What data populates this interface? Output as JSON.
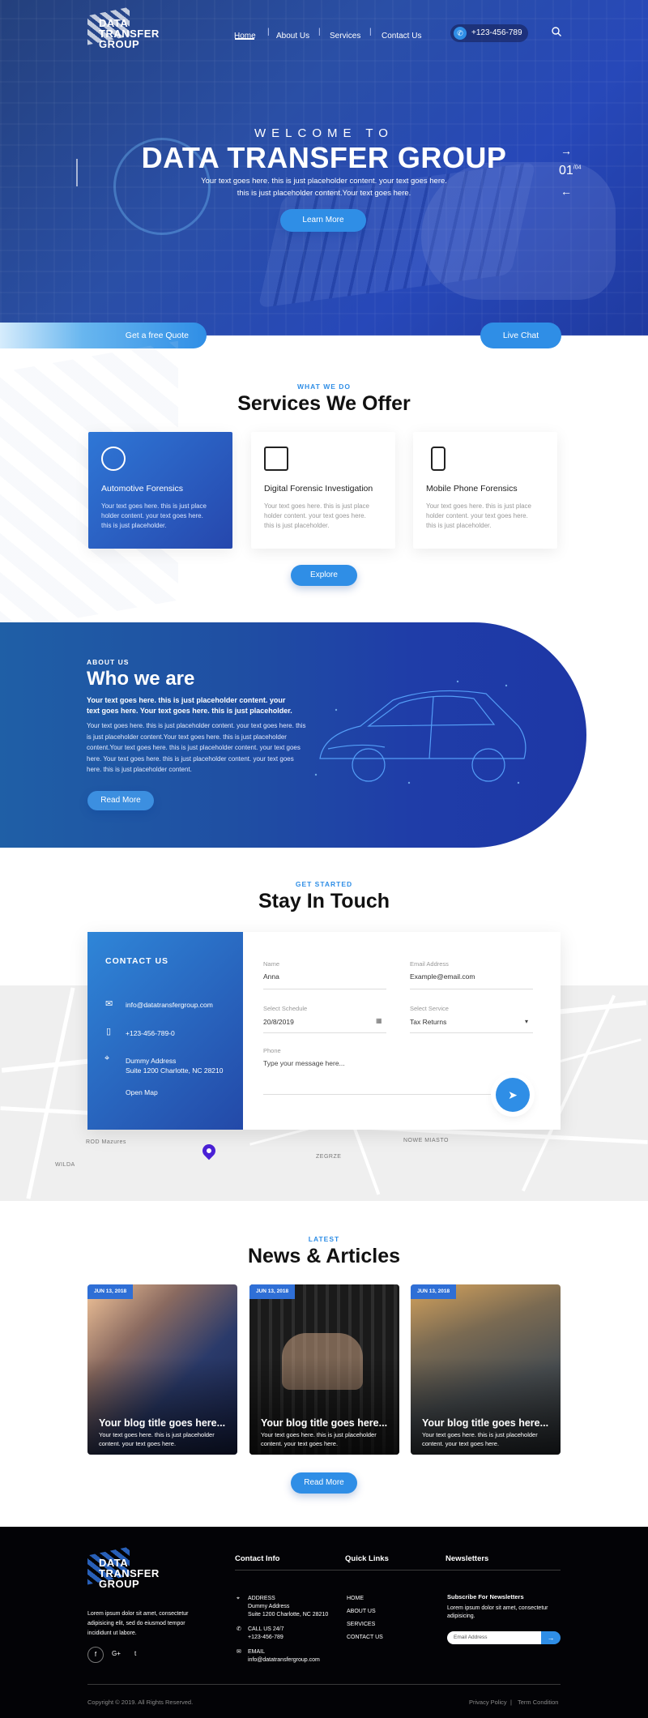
{
  "brand": {
    "logo_line1": "DATA",
    "logo_line2": "TRANSFER",
    "logo_line3": "GROUP",
    "accent": "#2f8ee6",
    "dark_blue": "#2647ad"
  },
  "nav": {
    "items": [
      "Home",
      "About Us",
      "Services",
      "Contact Us"
    ],
    "phone": "+123-456-789",
    "search_icon": "search-icon"
  },
  "hero": {
    "welcome": "WELCOME TO",
    "title": "DATA TRANSFER GROUP",
    "subtitle_line1": "Your text goes here. this is just placeholder content. your text goes here.",
    "subtitle_line2": "this is just placeholder content.Your text goes here.",
    "cta": "Learn More",
    "slide_current": "01",
    "slide_total": "/04",
    "quote_label": "Get a free Quote",
    "chat_label": "Live Chat"
  },
  "services": {
    "kicker": "WHAT WE DO",
    "title": "Services We Offer",
    "cards": [
      {
        "title": "Automotive Forensics",
        "body": "Your text goes here. this is just place holder content. your text goes here. this is just placeholder.",
        "icon": "steering-wheel-icon"
      },
      {
        "title": "Digital Forensic Investigation",
        "body": "Your text goes here. this is just place holder content. your text goes here. this is just placeholder.",
        "icon": "chip-icon"
      },
      {
        "title": "Mobile Phone Forensics",
        "body": "Your text goes here. this is just place holder content. your text goes here. this is just placeholder.",
        "icon": "mobile-phone-icon"
      }
    ],
    "cta": "Explore"
  },
  "about": {
    "kicker": "ABOUT US",
    "title": "Who we are",
    "lead": "Your text goes here. this is just placeholder content. your text goes here. Your text goes here. this is just placeholder.",
    "body": "Your text goes here. this is just placeholder content. your text goes here. this is just placeholder content.Your text goes here. this is just placeholder content.Your text goes here. this is just placeholder content. your text goes here. Your text goes here. this is just placeholder content. your text goes here. this is just placeholder content.",
    "cta": "Read More"
  },
  "contact": {
    "kicker": "GET STARTED",
    "title": "Stay In Touch",
    "panel_title": "CONTACT US",
    "email": "info@datatransfergroup.com",
    "phone": "+123-456-789-0",
    "address_line1": "Dummy Address",
    "address_line2": "Suite 1200 Charlotte, NC 28210",
    "open_map": "Open Map",
    "form": {
      "name_label": "Name",
      "name_value": "Anna",
      "email_label": "Email Address",
      "email_value": "Example@email.com",
      "schedule_label": "Select Schedule",
      "schedule_value": "20/8/2019",
      "service_label": "Select Service",
      "service_value": "Tax Returns",
      "phone_label": "Phone",
      "message_placeholder": "Type your message here..."
    },
    "map_labels": [
      "ROD Mazures",
      "WILDA",
      "ZEGRZE",
      "NOWE MIASTO"
    ]
  },
  "news": {
    "kicker": "LATEST",
    "title": "News & Articles",
    "items": [
      {
        "date": "JUN 13, 2018",
        "title": "Your blog title goes here...",
        "excerpt": "Your text goes here. this is just placeholder content. your text goes here."
      },
      {
        "date": "JUN 13, 2018",
        "title": "Your blog title goes here...",
        "excerpt": "Your text goes here. this is just placeholder content. your text goes here."
      },
      {
        "date": "JUN 13, 2018",
        "title": "Your blog title goes here...",
        "excerpt": "Your text goes here. this is just placeholder content. your text goes here."
      }
    ],
    "cta": "Read More"
  },
  "footer": {
    "about": "Lorem ipsum dolor sit amet, consectetur adipisicing elit, sed do eiusmod tempor incididunt ut labore.",
    "social": [
      "f",
      "G+",
      "t"
    ],
    "contact_title": "Contact Info",
    "address_label": "ADDRESS",
    "address_line1": "Dummy Address",
    "address_line2": "Suite 1200 Charlotte, NC 28210",
    "call_label": "CALL US 24/7",
    "call_value": "+123-456-789",
    "email_label": "EMAIL",
    "email_value": "info@datatransfergroup.com",
    "links_title": "Quick Links",
    "links": [
      "HOME",
      "ABOUT US",
      "SERVICES",
      "CONTACT US"
    ],
    "news_title": "Newsletters",
    "news_sub_title": "Subscribe For Newsletters",
    "news_text": "Lorem ipsum dolor sit amet, consectetur adipisicing.",
    "news_placeholder": "Email Address",
    "copyright": "Copyright © 2019. All Rights Reserved.",
    "privacy": "Privacy Policy",
    "terms": "Term Condition"
  }
}
